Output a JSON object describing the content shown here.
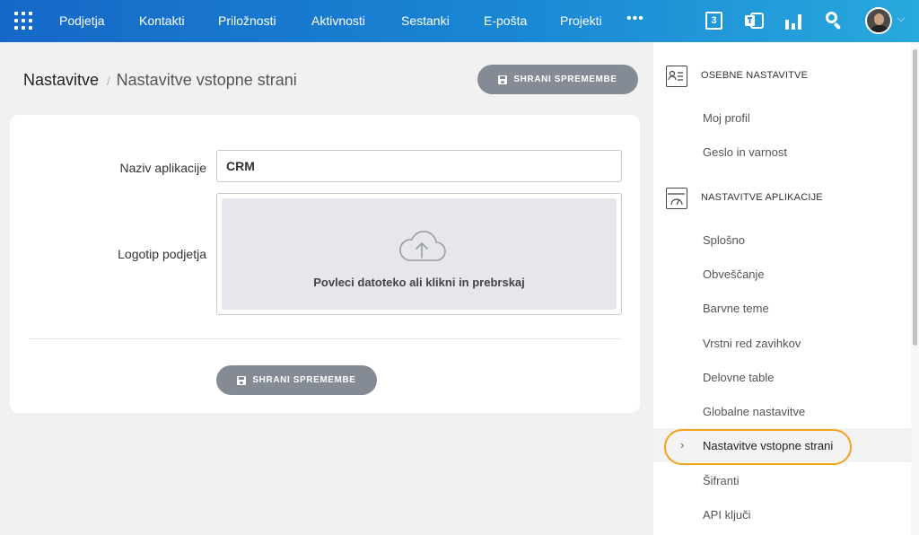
{
  "nav": {
    "items": [
      {
        "label": "Podjetja"
      },
      {
        "label": "Kontakti"
      },
      {
        "label": "Priložnosti"
      },
      {
        "label": "Aktivnosti"
      },
      {
        "label": "Sestanki"
      },
      {
        "label": "E-pošta"
      },
      {
        "label": "Projekti"
      }
    ],
    "more": "•••",
    "calendar_day": "3",
    "icons": [
      "apps-grid-icon",
      "calendar-icon",
      "teams-icon",
      "bar-chart-icon",
      "search-icon",
      "avatar",
      "chevron-down-icon"
    ],
    "caret": "⌵"
  },
  "header": {
    "breadcrumb_root": "Nastavitve",
    "breadcrumb_sep": "/",
    "breadcrumb_current": "Nastavitve vstopne strani",
    "save_label": "SHRANI SPREMEMBE"
  },
  "form": {
    "app_name_label": "Naziv aplikacije",
    "app_name_value": "CRM",
    "logo_label": "Logotip podjetja",
    "upload_text": "Povleci datoteko ali klikni in prebrskaj",
    "save_label": "SHRANI SPREMEMBE"
  },
  "sidebar": {
    "personal": {
      "title": "OSEBNE NASTAVITVE",
      "items": [
        "Moj profil",
        "Geslo in varnost"
      ]
    },
    "app": {
      "title": "NASTAVITVE APLIKACIJE",
      "items": [
        "Splošno",
        "Obveščanje",
        "Barvne teme",
        "Vrstni red zavihkov",
        "Delovne table",
        "Globalne nastavitve",
        "Nastavitve vstopne strani",
        "Šifranti",
        "API ključi"
      ],
      "active": "Nastavitve vstopne strani"
    },
    "chevron": "›"
  },
  "colors": {
    "accent": "#1a86d3",
    "highlight": "#f4a31d",
    "button": "#858b94"
  }
}
